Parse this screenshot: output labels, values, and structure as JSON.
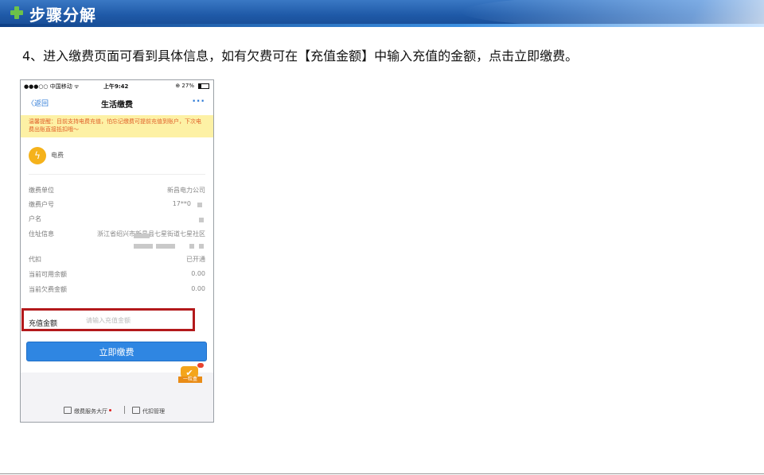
{
  "header": {
    "title": "步骤分解"
  },
  "instruction": "4、进入缴费页面可看到具体信息，如有欠费可在【充值金额】中输入充值的金额，点击立即缴费。",
  "phone": {
    "status": {
      "carrier": "●●●○○ 中国移动 ᯤ",
      "time": "上午9:42",
      "battery": "⊕ 27%"
    },
    "nav": {
      "back": "〈返回",
      "title": "生活缴费",
      "more": "···"
    },
    "notice": "温馨提醒：目前支持电费充值，怕忘记缴费可提前充值到账户，下次电费出账直接抵扣哦～",
    "fee_type": "电费",
    "rows": [
      {
        "label": "缴费单位",
        "value": "新昌电力公司"
      },
      {
        "label": "缴费户号",
        "value": "17**0"
      },
      {
        "label": "户名",
        "value": ""
      },
      {
        "label": "住址信息",
        "value": "浙江省绍兴市新昌县七星街道七星社区"
      },
      {
        "label": "代扣",
        "value": "已开通"
      },
      {
        "label": "当前可用余额",
        "value": "0.00"
      },
      {
        "label": "当前欠费金额",
        "value": "0.00"
      }
    ],
    "amount": {
      "label": "充值金额",
      "placeholder": "请输入充值金额"
    },
    "pay_button": "立即缴费",
    "badge_text": "一粒盒",
    "footer": {
      "hall": "缴费服务大厅",
      "auto_debit": "代扣管理"
    }
  },
  "colors": {
    "accent": "#2f86e2",
    "highlight": "#b3191b",
    "banner": "#1f5aa8"
  }
}
